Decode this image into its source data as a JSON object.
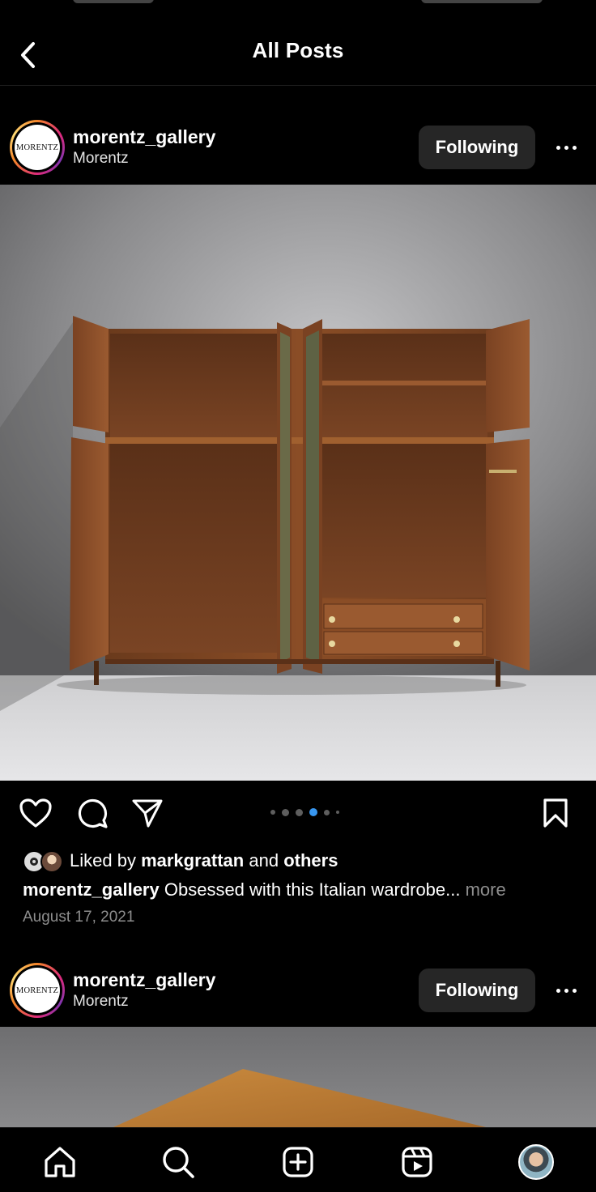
{
  "header": {
    "title": "All Posts",
    "back_icon": "chevron-left-icon"
  },
  "posts": [
    {
      "username": "morentz_gallery",
      "subname": "Morentz",
      "avatar_text": "MORENTZ",
      "follow_label": "Following",
      "liked_by_prefix": "Liked by",
      "liked_by_user": "markgrattan",
      "liked_by_and": "and",
      "liked_by_others": "others",
      "caption_user": "morentz_gallery",
      "caption_text": "Obsessed with this Italian wardrobe...",
      "caption_more": "more",
      "date": "August 17, 2021",
      "carousel_count": 6,
      "carousel_active": 3
    },
    {
      "username": "morentz_gallery",
      "subname": "Morentz",
      "avatar_text": "MORENTZ",
      "follow_label": "Following"
    }
  ],
  "colors": {
    "background": "#000000",
    "button": "#262626",
    "accent": "#3897f0",
    "muted": "#8e8e8e"
  },
  "nav": [
    "home-icon",
    "search-icon",
    "create-icon",
    "reels-icon",
    "profile-avatar"
  ]
}
